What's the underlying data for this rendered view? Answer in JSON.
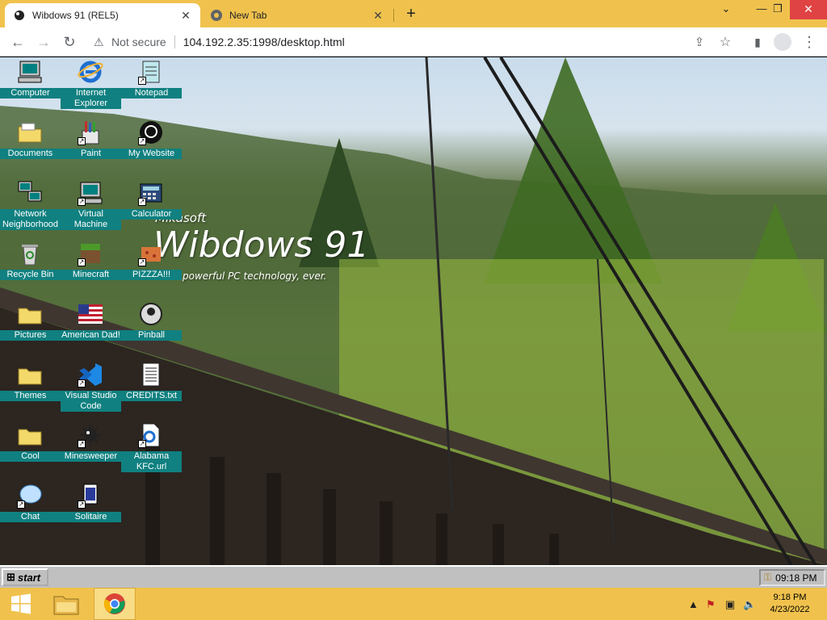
{
  "browser": {
    "tabs": [
      {
        "title": "Wibdows 91 (REL5)",
        "active": true
      },
      {
        "title": "New Tab",
        "active": false
      }
    ],
    "new_tab_symbol": "+",
    "security_label": "Not secure",
    "url": "104.192.2.35:1998/desktop.html",
    "window_controls": {
      "minimize": "⌄",
      "restore": "❐",
      "close": "✕"
    }
  },
  "desktop": {
    "brand_small": "Mikasoft",
    "brand_title": "Wibdows 91",
    "brand_tagline": "powerful PC technology, ever.",
    "icons": [
      {
        "label": "Computer",
        "icon": "computer-icon"
      },
      {
        "label": "Internet Explorer",
        "icon": "internet-explorer-icon"
      },
      {
        "label": "Notepad",
        "icon": "notepad-icon"
      },
      {
        "label": "Documents",
        "icon": "folder-icon"
      },
      {
        "label": "Paint",
        "icon": "paint-icon"
      },
      {
        "label": "My Website",
        "icon": "github-icon"
      },
      {
        "label": "Network Neighborhood",
        "icon": "network-icon"
      },
      {
        "label": "Virtual Machine",
        "icon": "computer-icon"
      },
      {
        "label": "Calculator",
        "icon": "calculator-icon"
      },
      {
        "label": "Recycle Bin",
        "icon": "recycle-bin-icon"
      },
      {
        "label": "Minecraft",
        "icon": "minecraft-icon"
      },
      {
        "label": "PIZZZA!!!",
        "icon": "pizza-icon"
      },
      {
        "label": "Pictures",
        "icon": "folder-icon"
      },
      {
        "label": "American Dad!",
        "icon": "us-flag-icon"
      },
      {
        "label": "Pinball",
        "icon": "pinball-icon"
      },
      {
        "label": "Themes",
        "icon": "folder-icon"
      },
      {
        "label": "Visual Studio Code",
        "icon": "vscode-icon"
      },
      {
        "label": "CREDITS.txt",
        "icon": "text-file-icon"
      },
      {
        "label": "Cool",
        "icon": "folder-icon"
      },
      {
        "label": "Minesweeper",
        "icon": "minesweeper-icon"
      },
      {
        "label": "Alabama KFC.url",
        "icon": "url-file-icon"
      },
      {
        "label": "Chat",
        "icon": "chat-icon"
      },
      {
        "label": "Solitaire",
        "icon": "solitaire-icon"
      }
    ]
  },
  "taskbar95": {
    "start_label": "start",
    "clock": "09:18 PM"
  },
  "taskbar8": {
    "time": "9:18 PM",
    "date": "4/23/2022"
  },
  "colors": {
    "chrome_frame": "#f0c24d",
    "icon_label_bg": "#108080",
    "win95_gray": "#c0c0c0"
  }
}
